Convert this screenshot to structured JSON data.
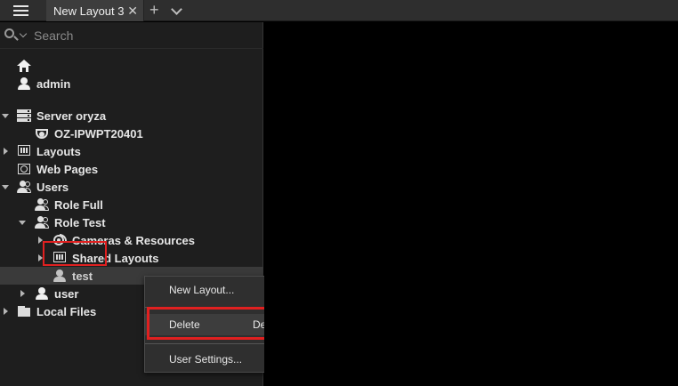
{
  "topbar": {
    "tab_title": "New Layout 3",
    "close_glyph": "✕",
    "add_glyph": "+"
  },
  "search": {
    "placeholder": "Search"
  },
  "tree": {
    "current_user": "admin",
    "server": "Server oryza",
    "camera": "OZ-IPWPT20401",
    "layouts": "Layouts",
    "web_pages": "Web Pages",
    "users": "Users",
    "role_full": "Role Full",
    "role_test": "Role Test",
    "cameras_resources": "Cameras & Resources",
    "shared_layouts": "Shared Layouts",
    "test_user": "test",
    "user": "user",
    "local_files": "Local Files"
  },
  "context_menu": {
    "items": [
      {
        "label": "New Layout...",
        "shortcut": ""
      },
      {
        "label": "Delete",
        "shortcut": "Del"
      },
      {
        "label": "User Settings...",
        "shortcut": ""
      }
    ]
  },
  "colors": {
    "highlight": "#e02020",
    "panel_bg": "#1e1e1e",
    "selection_bg": "#3a3a3a"
  }
}
